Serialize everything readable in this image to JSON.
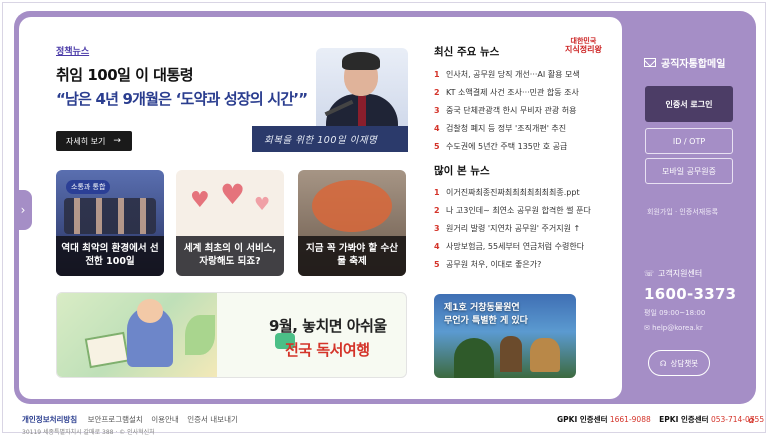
{
  "policy": {
    "label": "정책뉴스",
    "headline1": "취임 100일 이 대통령",
    "headline2": "“남은 4년 9개월은 ‘도약과 성장의 시간’”",
    "detail_button": "자세히 보기",
    "banner_text": "회복을 위한 100일 이재명"
  },
  "cards": [
    {
      "tag": "소통과 통합",
      "caption": "역대 최악의 환경에서 선전한 100일"
    },
    {
      "caption": "세계 최초의 이 서비스, 자랑해도 되죠?"
    },
    {
      "caption": "지금 꼭 가봐야 할 수산물 축제"
    }
  ],
  "reading_banner": {
    "line1": "9월, 놓치면 아쉬울",
    "line2": "전국 독서여행"
  },
  "top_news": {
    "title": "최신 주요 뉴스",
    "items": [
      {
        "num": "1",
        "text": "인사처, 공무원 당직 개선···AI 활용 모색"
      },
      {
        "num": "2",
        "text": "KT 소액결제 사건 조사···민관 합동 조사"
      },
      {
        "num": "3",
        "text": "중국 단체관광객 한시 무비자 관광 허용"
      },
      {
        "num": "4",
        "text": "검찰청 폐지 등 정부 '조직개편' 추진"
      },
      {
        "num": "5",
        "text": "수도권에 5년간 주택 135만 호 공급"
      }
    ]
  },
  "most_viewed": {
    "title": "많이 본 뉴스",
    "items": [
      {
        "num": "1",
        "text": "이거진짜최종진짜최최최최최최최종.ppt"
      },
      {
        "num": "2",
        "text": "나 고3인데~ 최연소 공무원 합격한 썰 푼다"
      },
      {
        "num": "3",
        "text": "원거리 발령 '지연차 공무원' 주거지원 ↑"
      },
      {
        "num": "4",
        "text": "사망보험금, 55세부터 연금처럼 수령한다"
      },
      {
        "num": "5",
        "text": "공무원 처우, 이대로 좋은가?"
      }
    ]
  },
  "logo_badge": {
    "line1": "대한민국",
    "line2": "지식정리왕"
  },
  "promo": {
    "line1": "제1호 거창동물원연",
    "line2": "무언가 특별한 게 있다"
  },
  "sidebar": {
    "mail_title": "공직자통합메일",
    "login_button": "인증서 로그인",
    "id_otp_button": "ID / OTP",
    "mobile_button": "모바일 공무원증",
    "links": "회원가입 · 인증서재등록",
    "cs_label": "고객지원센터",
    "cs_number": "1600-3373",
    "cs_hours": "평일 09:00~18:00",
    "cs_email": "help@korea.kr",
    "chat_button": "상담챗봇"
  },
  "footer": {
    "privacy": "개인정보처리방침",
    "security": "보안프로그램설치",
    "usage": "이용안내",
    "cert_export": "인증서 내보내기",
    "address": "30119 세종특별자치시 갈매로 388 · © 인사혁신처",
    "gpki": "GPKI 인증센터",
    "gpki_tel": "1661-9088",
    "epki": "EPKI 인증센터",
    "epki_tel": "053-714-0755"
  }
}
